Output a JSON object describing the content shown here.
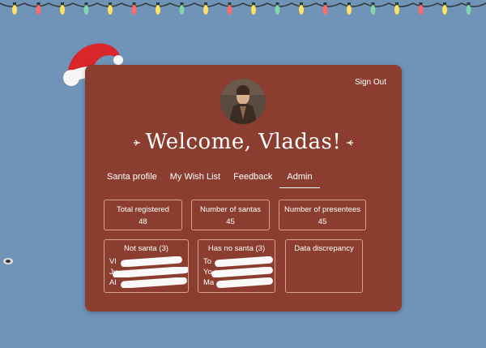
{
  "colors": {
    "background": "#7093b8",
    "card": "#8b3e2f",
    "border": "#d9a38f",
    "text": "#ffffff"
  },
  "lights": [
    "#ffe066",
    "#ff6b6b",
    "#ffe066",
    "#7fd6a6",
    "#ffe066",
    "#ff6b6b",
    "#ffe066",
    "#7fd6a6",
    "#ffe066",
    "#ff6b6b",
    "#ffe066",
    "#7fd6a6",
    "#ffe066",
    "#ff6b6b",
    "#ffe066",
    "#7fd6a6",
    "#ffe066",
    "#ff6b6b",
    "#ffe066",
    "#7fd6a6"
  ],
  "header": {
    "sign_out": "Sign Out",
    "welcome": "Welcome, Vladas!",
    "avatar_icon": "user-avatar"
  },
  "tabs": [
    {
      "label": "Santa profile",
      "active": false
    },
    {
      "label": "My Wish List",
      "active": false
    },
    {
      "label": "Feedback",
      "active": false
    },
    {
      "label": "Admin",
      "active": true
    }
  ],
  "stats": [
    {
      "title": "Total registered",
      "value": "48"
    },
    {
      "title": "Number of santas",
      "value": "45"
    },
    {
      "title": "Number of presentees",
      "value": "45"
    }
  ],
  "lists": [
    {
      "title": "Not santa (3)",
      "items": [
        "Vl",
        "Ju",
        "Al"
      ]
    },
    {
      "title": "Has no santa (3)",
      "items": [
        "To",
        "Yo",
        "Ma"
      ]
    },
    {
      "title": "Data discrepancy",
      "items": []
    }
  ],
  "decor": {
    "hat_icon": "santa-hat-icon",
    "ornament_icon": "ornament-icon"
  }
}
